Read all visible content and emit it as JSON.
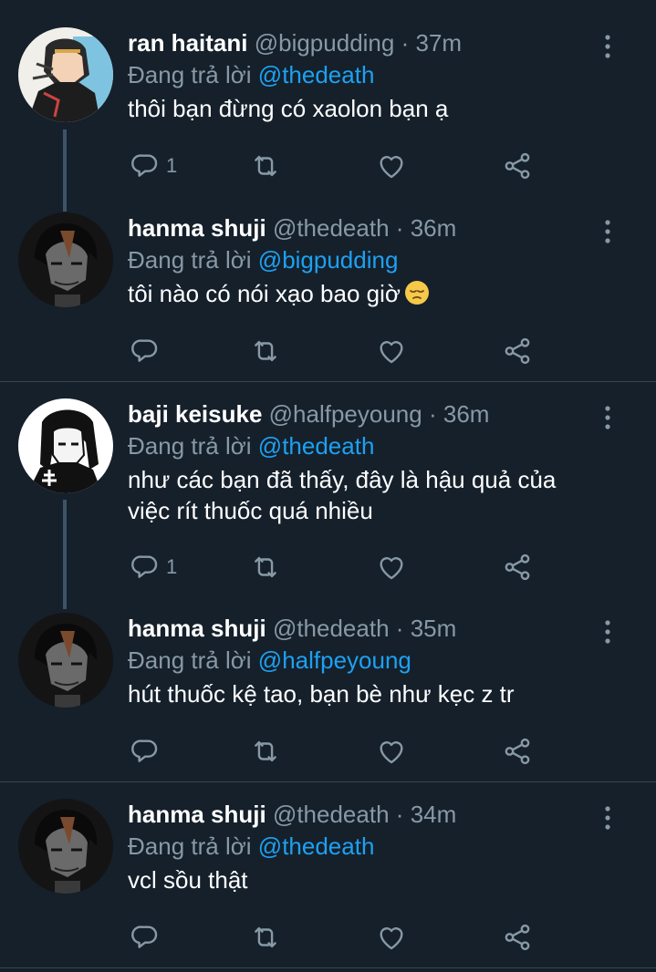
{
  "reply_prefix": "Đang trả lời",
  "separator": "·",
  "tweets": [
    {
      "name": "ran haitani",
      "handle": "@bigpudding",
      "time": "37m",
      "reply_to": "@thedeath",
      "text": "thôi bạn đừng có xaolon bạn ạ",
      "reply_count": "1"
    },
    {
      "name": "hanma shuji",
      "handle": "@thedeath",
      "time": "36m",
      "reply_to": "@bigpudding",
      "text": "tôi nào có nói xạo bao giờ",
      "emoji": "pensive-face",
      "reply_count": ""
    },
    {
      "name": "baji keisuke",
      "handle": "@halfpeyoung",
      "time": "36m",
      "reply_to": "@thedeath",
      "text_line1": "như các bạn đã thấy, đây là hậu quả của",
      "text_line2": "việc rít thuốc quá nhiều",
      "reply_count": "1"
    },
    {
      "name": "hanma shuji",
      "handle": "@thedeath",
      "time": "35m",
      "reply_to": "@halfpeyoung",
      "text": "hút thuốc kệ tao, bạn bè như kẹc z tr",
      "reply_count": ""
    },
    {
      "name": "hanma shuji",
      "handle": "@thedeath",
      "time": "34m",
      "reply_to": "@thedeath",
      "text": "vcl sồu thật",
      "reply_count": ""
    }
  ],
  "icons": {
    "reply": "reply-icon",
    "retweet": "retweet-icon",
    "like": "heart-icon",
    "share": "share-icon",
    "more": "more-vertical-icon"
  },
  "colors": {
    "background": "#15202b",
    "secondary_text": "#8899a6",
    "link": "#1da1f2",
    "divider": "#38444d"
  }
}
